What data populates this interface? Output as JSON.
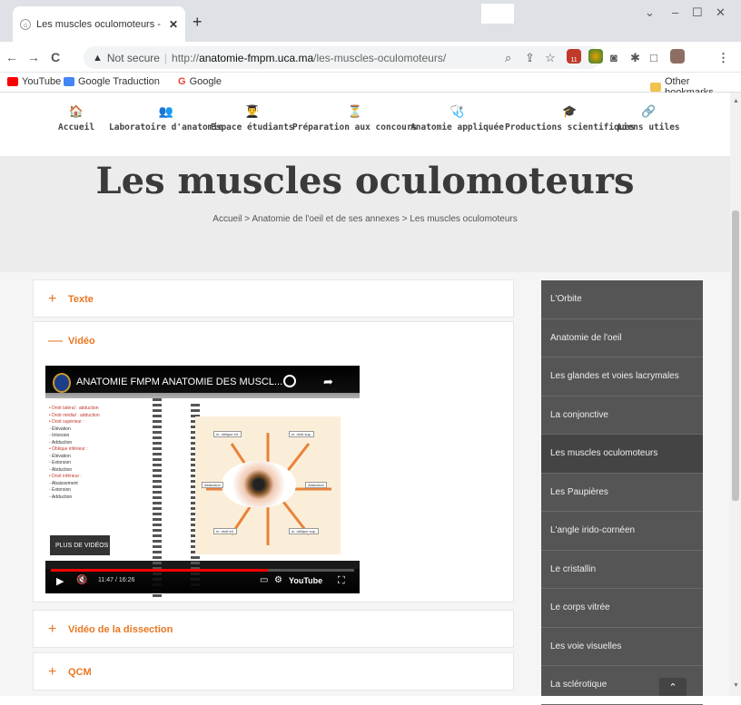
{
  "browser": {
    "tab_title": "Les muscles oculomoteurs - Labo",
    "tab_close": "✕",
    "new_tab": "+",
    "window_controls": [
      "⌄",
      "–",
      "☐",
      "✕"
    ],
    "back": "←",
    "forward": "→",
    "reload": "C",
    "security_warning": "▲",
    "not_secure": "Not secure",
    "url_scheme": "http://",
    "url_domain": "anatomie-fmpm.uca.ma",
    "url_path": "/les-muscles-oculomoteurs/",
    "ext_badge": "11",
    "bookmarks": [
      {
        "label": "YouTube",
        "color": "#ff0000"
      },
      {
        "label": "Google Traduction",
        "color": "#4285f4"
      },
      {
        "label": "Google",
        "color": "#ea4335"
      }
    ],
    "other_bookmarks": "Other bookmarks"
  },
  "site": {
    "nav": [
      {
        "icon": "🏠",
        "label": "Accueil"
      },
      {
        "icon": "👥",
        "label": "Laboratoire d'anatomie"
      },
      {
        "icon": "👨‍🎓",
        "label": "Espace étudiants"
      },
      {
        "icon": "⏳",
        "label": "Préparation aux concours"
      },
      {
        "icon": "🩺",
        "label": "Anatomie appliquée"
      },
      {
        "icon": "🎓",
        "label": "Productions scientifiques"
      },
      {
        "icon": "🔗",
        "label": "Liens utiles"
      }
    ],
    "page_title": "Les muscles oculomoteurs",
    "breadcrumb": "Accueil > Anatomie de l'oeil et de ses annexes > Les muscles oculomoteurs"
  },
  "accordion": [
    {
      "symbol": "+",
      "label": "Texte"
    },
    {
      "symbol": "—",
      "label": "Vidéo"
    },
    {
      "symbol": "+",
      "label": "Vidéo de la dissection"
    },
    {
      "symbol": "+",
      "label": "QCM"
    }
  ],
  "video": {
    "title": "ANATOMIE FMPM ANATOMIE DES MUSCL...",
    "more_videos": "PLUS DE VIDÉOS",
    "time": "11:47 / 16:26",
    "progress": 0.717,
    "youtube": "YouTube",
    "slide_lines": [
      {
        "t": "• Droit latéral : abduction",
        "red": true
      },
      {
        "t": "• Droit médial : adduction",
        "red": true
      },
      {
        "t": "• Droit supérieur :",
        "red": true
      },
      {
        "t": "   ◦ Élévation",
        "red": false
      },
      {
        "t": "   ◦ Intorsion",
        "red": false
      },
      {
        "t": "   ◦ Adduction",
        "red": false
      },
      {
        "t": "• Oblique inférieur :",
        "red": true
      },
      {
        "t": "   ◦ Élévation",
        "red": false
      },
      {
        "t": "   ◦ Extorsion",
        "red": false
      },
      {
        "t": "   ◦ Abduction",
        "red": false
      },
      {
        "t": "• Droit inférieur :",
        "red": true
      },
      {
        "t": "   ◦ Abaissement",
        "red": false
      },
      {
        "t": "   ◦ Extorsion",
        "red": false
      },
      {
        "t": "   ◦ Adduction",
        "red": false
      }
    ],
    "diagram_labels": [
      "m. oblique inf.",
      "m. droit sup.",
      "Abduction",
      "Adduction",
      "m. droit inf.",
      "m. oblique sup."
    ]
  },
  "sidebar": [
    "L'Orbite",
    "Anatomie de l'oeil",
    "Les glandes et voies lacrymales",
    "La conjonctive",
    "Les muscles oculomoteurs",
    "Les Paupières",
    "L'angle irido-cornéen",
    "Le cristallin",
    "Le corps vitrée",
    "Les voie visuelles",
    "La sclérotique"
  ],
  "sidebar_active": 4,
  "back_to_top": "⌃"
}
